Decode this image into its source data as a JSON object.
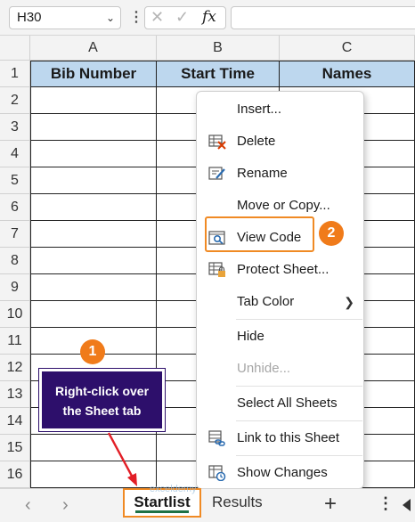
{
  "formula_bar": {
    "name_box": "H30",
    "cancel_icon": "✕",
    "enter_icon": "✓",
    "fx_label": "fx"
  },
  "columns": [
    "A",
    "B",
    "C"
  ],
  "rows": [
    "1",
    "2",
    "3",
    "4",
    "5",
    "6",
    "7",
    "8",
    "9",
    "10",
    "11",
    "12",
    "13",
    "14",
    "15",
    "16"
  ],
  "headers": {
    "a1": "Bib Number",
    "b1": "Start Time",
    "c1": "Names"
  },
  "context_menu": {
    "items": [
      {
        "label": "Insert...",
        "icon": "none"
      },
      {
        "label": "Delete",
        "icon": "delete-sheet-icon"
      },
      {
        "label": "Rename",
        "icon": "rename-icon"
      },
      {
        "label": "Move or Copy...",
        "icon": "none"
      },
      {
        "label": "View Code",
        "icon": "view-code-icon"
      },
      {
        "label": "Protect Sheet...",
        "icon": "protect-sheet-icon"
      },
      {
        "label": "Tab Color",
        "icon": "none",
        "submenu": true
      },
      {
        "label": "Hide",
        "icon": "none"
      },
      {
        "label": "Unhide...",
        "icon": "none",
        "disabled": true
      },
      {
        "label": "Select All Sheets",
        "icon": "none"
      },
      {
        "label": "Link to this Sheet",
        "icon": "link-icon"
      },
      {
        "label": "Show Changes",
        "icon": "show-changes-icon"
      }
    ]
  },
  "annotations": {
    "step1": "1",
    "step2": "2",
    "callout_line1": "Right-click over",
    "callout_line2": "the Sheet tab",
    "accent_color": "#f08a24",
    "callout_color": "#2d0f6b"
  },
  "sheet_tabs": {
    "active": "Startlist",
    "other": "Results",
    "add_label": "+"
  },
  "watermark": "exceldemy"
}
